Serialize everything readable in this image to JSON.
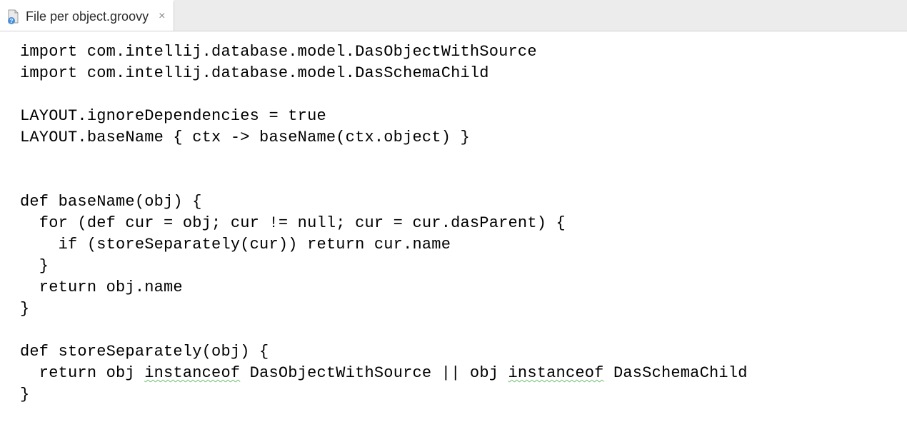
{
  "tab": {
    "filename": "File per object.groovy"
  },
  "code": {
    "l1": "import com.intellij.database.model.DasObjectWithSource",
    "l2": "import com.intellij.database.model.DasSchemaChild",
    "l3": "",
    "l4": "LAYOUT.ignoreDependencies = true",
    "l5": "LAYOUT.baseName { ctx -> baseName(ctx.object) }",
    "l6": "",
    "l7": "",
    "l8": "def baseName(obj) {",
    "l9": "  for (def cur = obj; cur != null; cur = cur.dasParent) {",
    "l10": "    if (storeSeparately(cur)) return cur.name",
    "l11": "  }",
    "l12": "  return obj.name",
    "l13": "}",
    "l14": "",
    "l15": "def storeSeparately(obj) {",
    "l16a": "  return obj ",
    "l16b": "instanceof",
    "l16c": " DasObjectWithSource || obj ",
    "l16d": "instanceof",
    "l16e": " DasSchemaChild",
    "l17": "}"
  }
}
